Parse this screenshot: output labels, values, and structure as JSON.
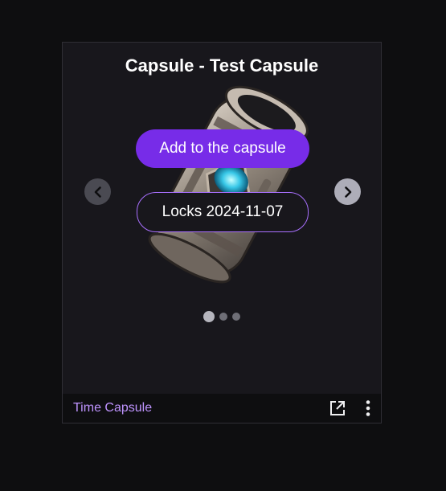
{
  "panel": {
    "title": "Capsule - Test Capsule",
    "add_button_label": "Add to the capsule",
    "lock_button_label": "Locks 2024-11-07",
    "carousel": {
      "slide_count": 3,
      "active_index": 0
    }
  },
  "footer": {
    "label": "Time Capsule",
    "icons": [
      "popout-icon",
      "more-options-icon"
    ]
  },
  "colors": {
    "background": "#0e0e10",
    "panel": "#18171c",
    "accent": "#772ce8",
    "accent_border": "#a970ff",
    "link": "#bf94ff"
  },
  "icons": {
    "left_arrow": "chevron-left-icon",
    "right_arrow": "chevron-right-icon",
    "capsule_image": "capsule-image"
  }
}
